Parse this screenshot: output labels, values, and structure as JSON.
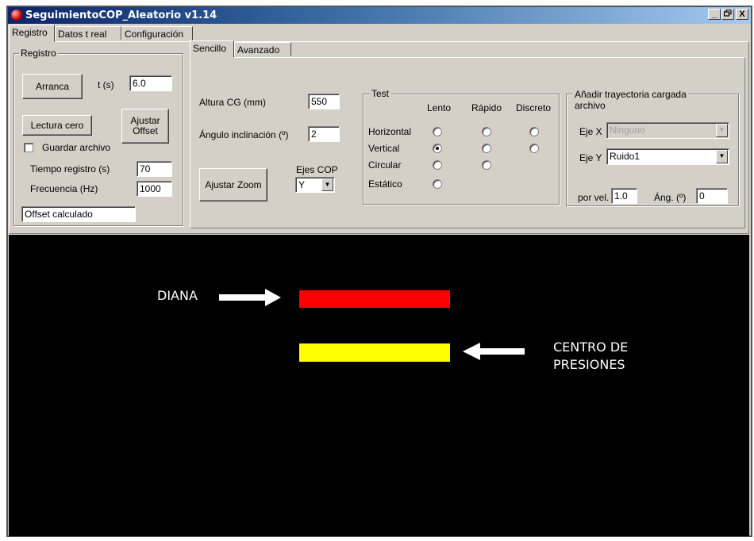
{
  "window": {
    "title": "SeguimientoCOP_Aleatorio   v1.14",
    "minimize": "_",
    "maximize": "🗗",
    "close": "X"
  },
  "tabs": [
    "Registro",
    "Datos t real",
    "Configuración"
  ],
  "registro": {
    "legend": "Registro",
    "arranca": "Arranca",
    "t_label": "t (s)",
    "t_value": "6.0",
    "lectura_cero": "Lectura cero",
    "ajustar_offset": "Ajustar Offset",
    "guardar_archivo": "Guardar archivo",
    "guardar_checked": false,
    "tiempo_label": "Tiempo registro (s)",
    "tiempo_value": "70",
    "frecuencia_label": "Frecuencia (Hz)",
    "frecuencia_value": "1000",
    "offset_calculado": "Offset calculado"
  },
  "subtabs": [
    "Sencillo",
    "Avanzado"
  ],
  "sencillo": {
    "altura_label": "Altura CG (mm)",
    "altura_value": "550",
    "angulo_label": "Ángulo inclinación (º)",
    "angulo_value": "2",
    "ajustar_zoom": "Ajustar Zoom",
    "ejes_label": "Ejes COP",
    "ejes_value": "Y"
  },
  "test": {
    "legend": "Test",
    "columns": [
      "Lento",
      "Rápido",
      "Discreto"
    ],
    "rows": [
      {
        "label": "Horizontal",
        "options": [
          false,
          false,
          false
        ]
      },
      {
        "label": "Vertical",
        "options": [
          true,
          false,
          false
        ]
      },
      {
        "label": "Circular",
        "options": [
          false,
          false
        ]
      },
      {
        "label": "Estático",
        "options": [
          false
        ]
      }
    ]
  },
  "trayectoria": {
    "legend_line1": "Añadir trayectoria cargada",
    "legend_line2": "archivo",
    "eje_x_label": "Eje X",
    "eje_x_value": "Ninguno",
    "eje_y_label": "Eje Y",
    "eje_y_value": "Ruido1",
    "por_vel_label": "por vel.",
    "por_vel_value": "1.0",
    "ang_label": "Áng. (º)",
    "ang_value": "0"
  },
  "canvas": {
    "diana_label": "DIANA",
    "cop_label_line1": "CENTRO DE",
    "cop_label_line2": "PRESIONES",
    "diana_color": "#ff0000",
    "cop_color": "#ffff00",
    "background": "#000000"
  },
  "icons": {
    "dropdown": "▼",
    "app_icon": "app-icon"
  }
}
